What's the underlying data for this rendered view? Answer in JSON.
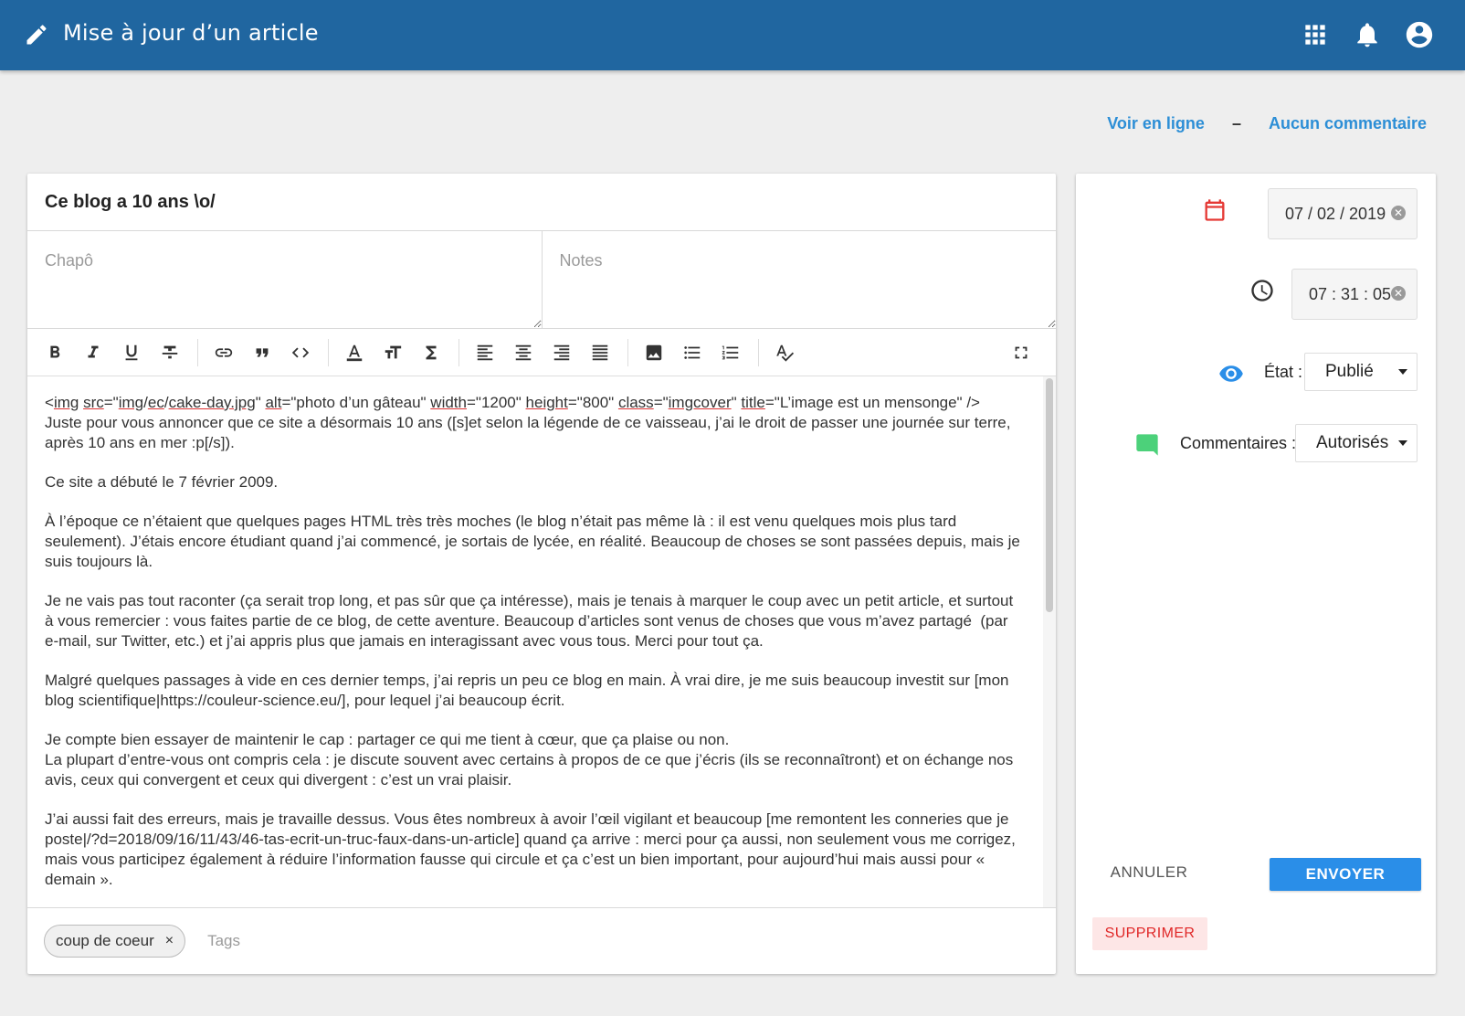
{
  "header": {
    "title": "Mise à jour d’un article",
    "icons": [
      "pencil-icon",
      "apps-grid-icon",
      "bell-icon",
      "account-circle-icon"
    ]
  },
  "top_links": {
    "view_online": "Voir en ligne",
    "separator": "–",
    "comments": "Aucun commentaire"
  },
  "article": {
    "title_value": "Ce blog a 10 ans \\o/",
    "chapo_placeholder": "Chapô",
    "notes_placeholder": "Notes"
  },
  "toolbar": {
    "buttons": [
      "bold-icon",
      "italic-icon",
      "underline-icon",
      "strikethrough-icon",
      "link-icon",
      "quote-icon",
      "code-icon",
      "font-color-icon",
      "text-size-icon",
      "sigma-icon",
      "align-left-icon",
      "align-center-icon",
      "align-right-icon",
      "align-justify-icon",
      "image-icon",
      "bullet-list-icon",
      "numbered-list-icon",
      "spellcheck-icon",
      "fullscreen-icon"
    ]
  },
  "editor": {
    "paragraphs": [
      "Juste pour vous annoncer que ce site a désormais 10 ans ([s]et selon la légende de ce vaisseau, j’ai le droit de passer une journée sur terre, après 10 ans en mer :p[/s]).",
      "Ce site a débuté le 7 février 2009.",
      "À l’époque ce n’étaient que quelques pages HTML très très moches (le blog n’était pas même là : il est venu quelques mois plus tard seulement). J’étais encore étudiant quand j’ai commencé, je sortais de lycée, en réalité. Beaucoup de choses se sont passées depuis, mais je suis toujours là.",
      "Je ne vais pas tout raconter (ça serait trop long, et pas sûr que ça intéresse), mais je tenais à marquer le coup avec un petit article, et surtout à vous remercier : vous faites partie de ce blog, de cette aventure. Beaucoup d’articles sont venus de choses que vous m’avez partagé  (par e-mail, sur Twitter, etc.) et j’ai appris plus que jamais en interagissant avec vous tous. Merci pour tout ça.",
      "Malgré quelques passages à vide en ces dernier temps, j’ai repris un peu ce blog en main. À vrai dire, je me suis beaucoup investit sur [mon blog scientifique|https://couleur-science.eu/], pour lequel j’ai beaucoup écrit.",
      "Je compte bien essayer de maintenir le cap : partager ce qui me tient à cœur, que ça plaise ou non.\nLa plupart d’entre-vous ont compris cela : je discute souvent avec certains à propos de ce que j’écris (ils se reconnaîtront) et on échange nos avis, ceux qui convergent et ceux qui divergent : c’est un vrai plaisir.",
      "J’ai aussi fait des erreurs, mais je travaille dessus. Vous êtes nombreux à avoir l’œil vigilant et beaucoup [me remontent les conneries que je poste|/?d=2018/09/16/11/43/46-tas-ecrit-un-truc-faux-dans-un-article] quand ça arrive : merci pour ça aussi, non seulement vous me corrigez, mais vous participez également à réduire l’information fausse qui circule et ça c’est un bien important, pour aujourd’hui mais aussi pour « demain »."
    ]
  },
  "tags": {
    "chips": [
      "coup de coeur"
    ],
    "remove_symbol": "×",
    "placeholder": "Tags"
  },
  "side": {
    "date": "07 / 02 / 2019",
    "time": "07 : 31 : 05",
    "state_label": "État :",
    "state_value": "Publié",
    "comments_label": "Commentaires :",
    "comments_value": "Autorisés",
    "cancel": "ANNULER",
    "send": "ENVOYER",
    "delete": "SUPPRIMER"
  },
  "colors": {
    "appbar": "#2066a0",
    "link": "#2c8ed6",
    "send": "#2a8ee8",
    "delete_text": "#e02828",
    "delete_bg": "#fde6e6",
    "calendar_icon": "#e53935",
    "eye_icon": "#2a8ee8",
    "comment_icon": "#4cd17a"
  }
}
